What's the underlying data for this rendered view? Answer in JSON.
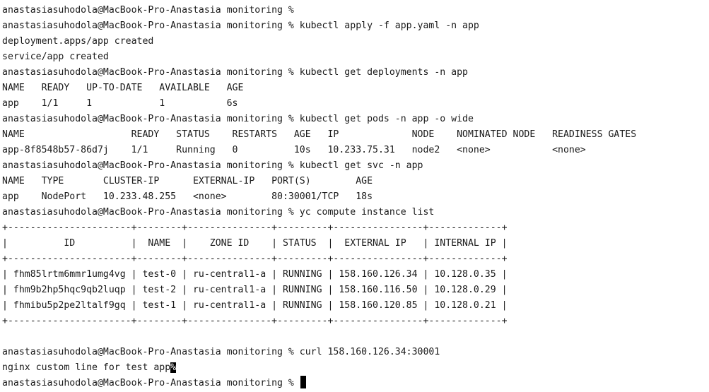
{
  "terminal": {
    "lines": [
      "anastasiasuhodola@MacBook-Pro-Anastasia monitoring %",
      "anastasiasuhodola@MacBook-Pro-Anastasia monitoring % kubectl apply -f app.yaml -n app",
      "deployment.apps/app created",
      "service/app created",
      "anastasiasuhodola@MacBook-Pro-Anastasia monitoring % kubectl get deployments -n app",
      "NAME   READY   UP-TO-DATE   AVAILABLE   AGE",
      "app    1/1     1            1           6s",
      "anastasiasuhodola@MacBook-Pro-Anastasia monitoring % kubectl get pods -n app -o wide",
      "NAME                   READY   STATUS    RESTARTS   AGE   IP             NODE    NOMINATED NODE   READINESS GATES",
      "app-8f8548b57-86d7j    1/1     Running   0          10s   10.233.75.31   node2   <none>           <none>",
      "anastasiasuhodola@MacBook-Pro-Anastasia monitoring % kubectl get svc -n app",
      "NAME   TYPE       CLUSTER-IP      EXTERNAL-IP   PORT(S)        AGE",
      "app    NodePort   10.233.48.255   <none>        80:30001/TCP   18s",
      "anastasiasuhodola@MacBook-Pro-Anastasia monitoring % yc compute instance list",
      "+----------------------+--------+---------------+---------+----------------+-------------+",
      "|          ID          |  NAME  |    ZONE ID    | STATUS  |  EXTERNAL IP   | INTERNAL IP |",
      "+----------------------+--------+---------------+---------+----------------+-------------+",
      "| fhm85lrtm6mmr1umg4vg | test-0 | ru-central1-a | RUNNING | 158.160.126.34 | 10.128.0.35 |",
      "| fhm9b2hp5hqc9qb2luqp | test-2 | ru-central1-a | RUNNING | 158.160.116.50 | 10.128.0.29 |",
      "| fhmibu5p2pe2ltalf9gq | test-1 | ru-central1-a | RUNNING | 158.160.120.85 | 10.128.0.21 |",
      "+----------------------+--------+---------------+---------+----------------+-------------+",
      "",
      "anastasiasuhodola@MacBook-Pro-Anastasia monitoring % curl 158.160.126.34:30001"
    ],
    "curl_output": "nginx custom line for test app",
    "eof_marker": "%",
    "final_prompt": "anastasiasuhodola@MacBook-Pro-Anastasia monitoring % "
  }
}
